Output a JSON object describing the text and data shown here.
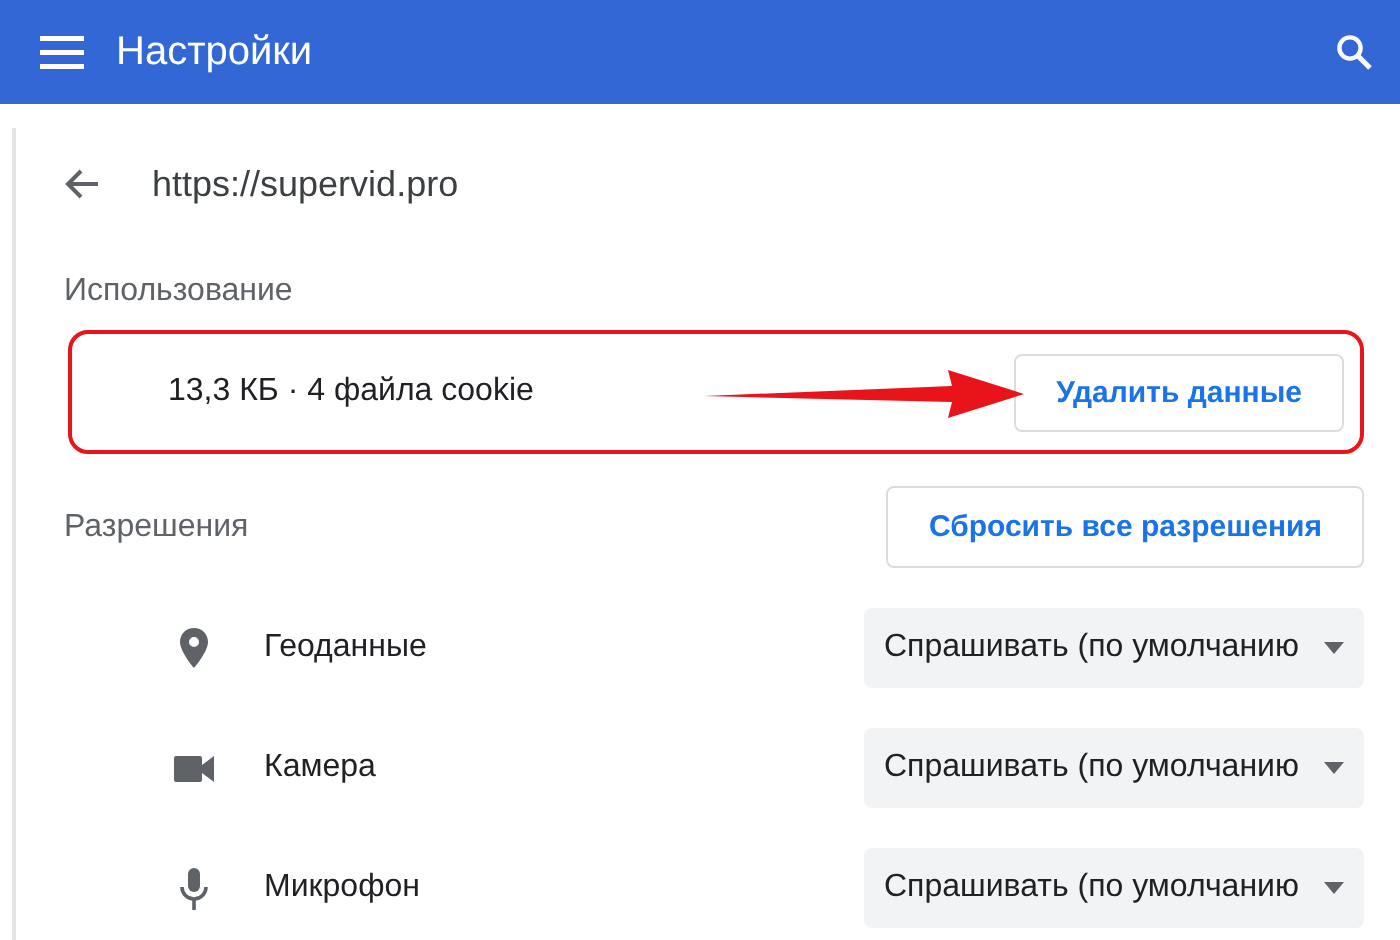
{
  "header": {
    "title": "Настройки"
  },
  "site": {
    "url": "https://supervid.pro"
  },
  "usage": {
    "heading": "Использование",
    "summary": "13,3 КБ · 4 файла cookie",
    "button": "Удалить данные"
  },
  "permissions": {
    "heading": "Разрешения",
    "reset_button": "Сбросить все разрешения",
    "items": [
      {
        "kind": "location",
        "label": "Геоданные",
        "value": "Спрашивать (по умолчанию"
      },
      {
        "kind": "camera",
        "label": "Камера",
        "value": "Спрашивать (по умолчанию"
      },
      {
        "kind": "microphone",
        "label": "Микрофон",
        "value": "Спрашивать (по умолчанию"
      }
    ]
  }
}
